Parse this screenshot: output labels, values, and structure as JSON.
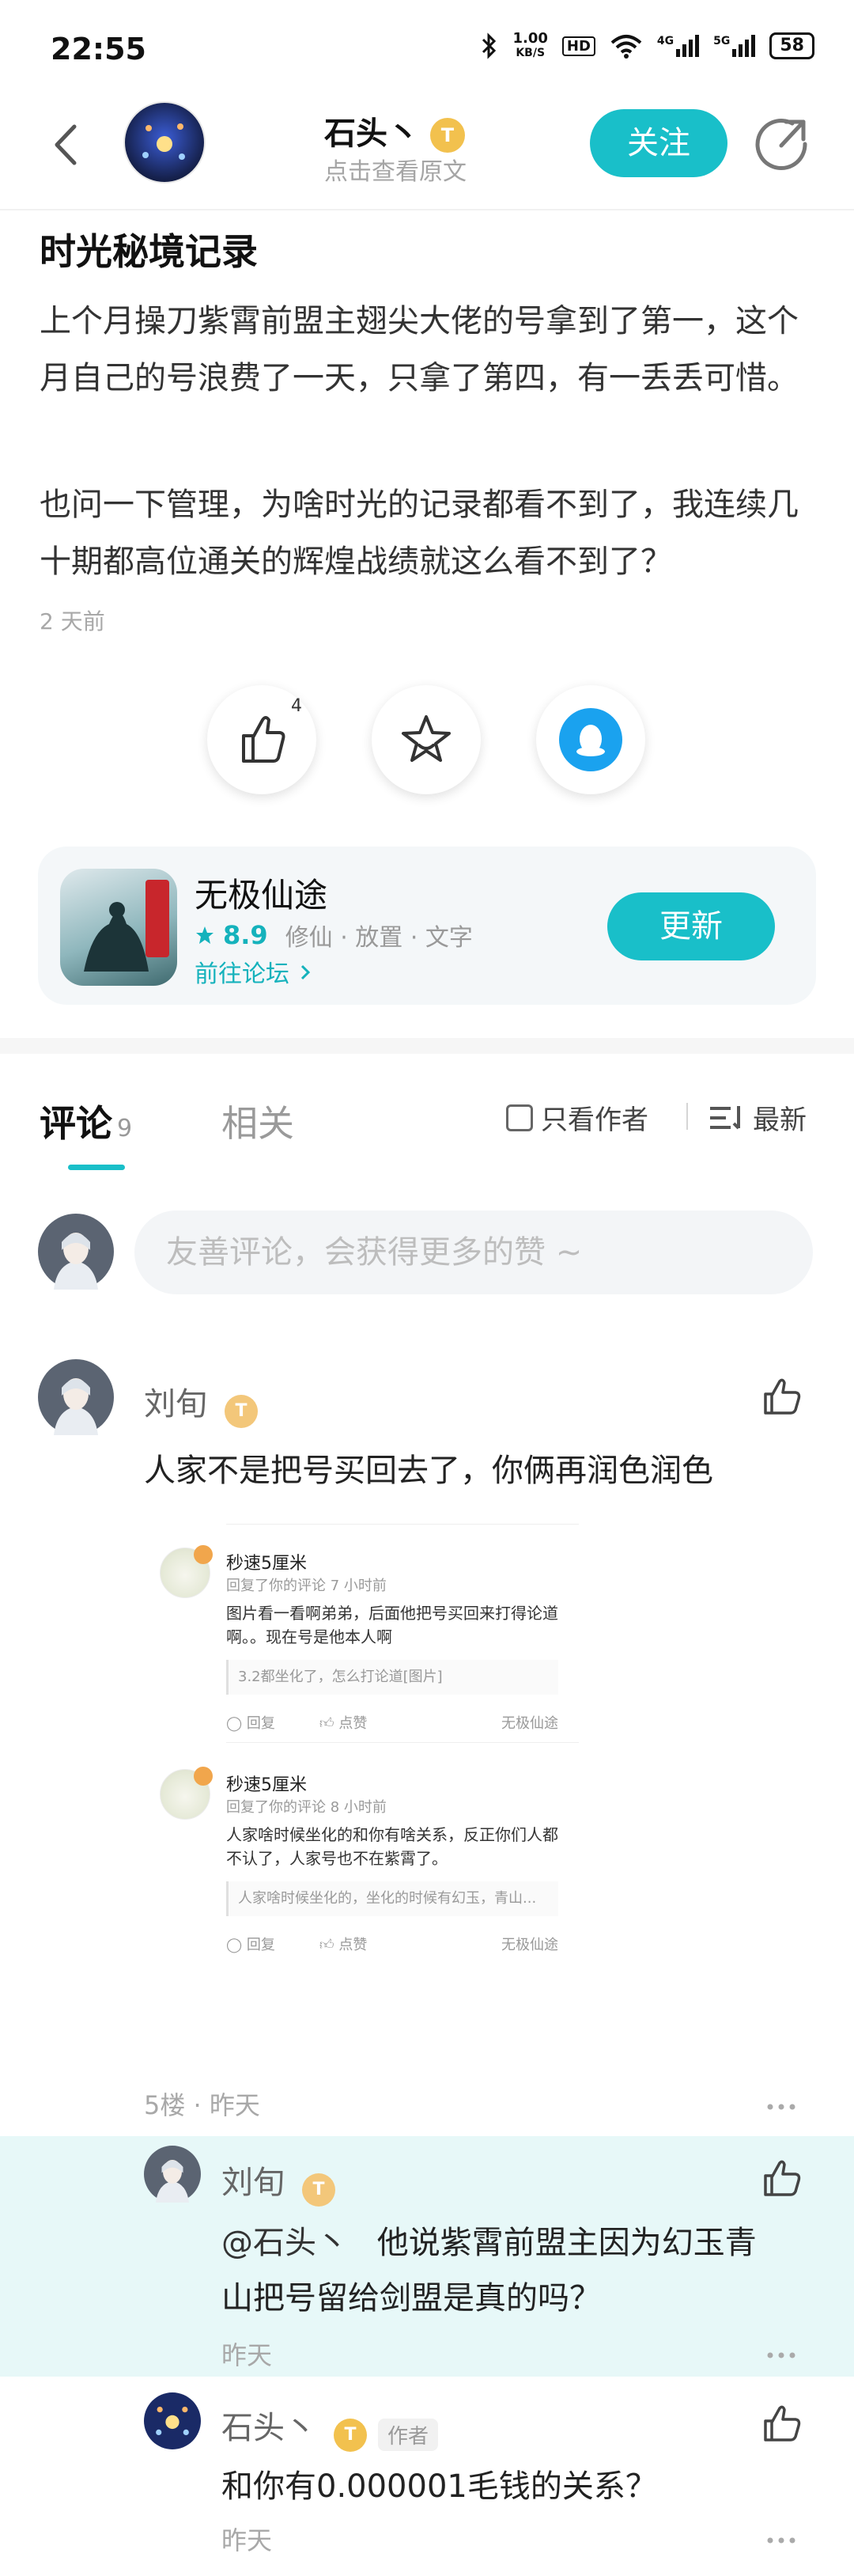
{
  "status_bar": {
    "time": "22:55",
    "net_speed_top": "1.00",
    "net_speed_bottom": "KB/S",
    "hd": "HD",
    "sig1": "4G",
    "sig2": "5G",
    "battery": "58"
  },
  "topbar": {
    "author_name": "石头丶",
    "author_level": "T",
    "subtitle": "点击查看原文",
    "follow_label": "关注"
  },
  "post": {
    "title": "时光秘境记录",
    "paragraph1": "上个月操刀紫霄前盟主翅尖大佬的号拿到了第一，这个月自己的号浪费了一天，只拿了第四，有一丢丢可惜。",
    "paragraph2": "也问一下管理，为啥时光的记录都看不到了，我连续几十期都高位通关的辉煌战绩就这么看不到了？",
    "time": "2 天前",
    "like_count": "4"
  },
  "game_card": {
    "name": "无极仙途",
    "score": "8.9",
    "tags": "修仙 · 放置 · 文字",
    "forum_link": "前往论坛",
    "update_label": "更新"
  },
  "tabs": {
    "comments_label": "评论",
    "comments_count": "9",
    "related_label": "相关",
    "only_author_label": "只看作者",
    "sort_label": "最新"
  },
  "comment_input": {
    "placeholder": "友善评论，会获得更多的赞 ~"
  },
  "comment": {
    "author": "刘旬",
    "badge": "T",
    "text": "人家不是把号买回去了，你俩再润色润色",
    "meta": "5楼 · 昨天",
    "embedded": [
      {
        "name": "秒速5厘米",
        "sub": "回复了你的评论 7 小时前",
        "body": "图片看一看啊弟弟，后面他把号买回来打得论道啊。。现在号是他本人啊",
        "quote": "3.2都坐化了，怎么打论道[图片]",
        "reply": "回复",
        "like": "点赞",
        "forum": "无极仙途"
      },
      {
        "name": "秒速5厘米",
        "sub": "回复了你的评论 8 小时前",
        "body": "人家啥时候坐化的和你有啥关系，反正你们人都不认了，人家号也不在紫霄了。",
        "quote": "人家啥时候坐化的，坐化的时候有幻玉，青山...",
        "reply": "回复",
        "like": "点赞",
        "forum": "无极仙途"
      }
    ]
  },
  "replies": [
    {
      "author": "刘旬",
      "badge": "T",
      "mention": "@石头丶",
      "text_line1": "他说紫霄前盟主因为幻玉青",
      "text_line2": "山把号留给剑盟是真的吗？",
      "time": "昨天"
    },
    {
      "author": "石头丶",
      "badge": "T",
      "author_tag": "作者",
      "text": "和你有0.000001毛钱的关系？",
      "time": "昨天"
    }
  ],
  "colors": {
    "accent": "#19bfc9",
    "highlight_bg": "#e7f8f8"
  }
}
